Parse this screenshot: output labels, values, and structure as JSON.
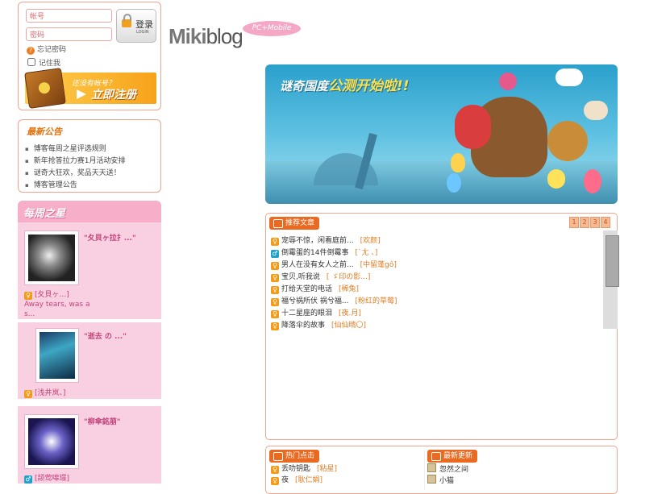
{
  "login": {
    "account_placeholder": "帐号",
    "password_placeholder": "密码",
    "login_label": "登录",
    "login_sub": "LOGIN",
    "forgot": "忘记密码",
    "remember": "记住我",
    "register_question": "还没有帐号？",
    "register_label": "立即注册"
  },
  "logo": {
    "miki": "Miki",
    "blog": "blog",
    "tag": "PC+Mobile"
  },
  "news": {
    "title": "最新公告",
    "items": [
      "博客每周之星评选规则",
      "新年抢答拉力赛1月活动安排",
      "谜奇大狂欢，奖品天天送！",
      "博客管理公告"
    ]
  },
  "weekly": {
    "title": "每周之星",
    "stars": [
      {
        "name": "\"夂貝ヶ拉扌...\"",
        "user": "[夂貝ヶ...]",
        "desc": "Away tears, was a s..."
      },
      {
        "name": "\"逝去 の ...\"",
        "user": "[浅井岚、]",
        "desc": ""
      },
      {
        "name": "\"柳傘銘萠\"",
        "user": "[颉莺嗥璟]",
        "desc": ""
      }
    ]
  },
  "banner": {
    "text_a": "谜奇国度",
    "text_b": "公测开始啦!!"
  },
  "recommend": {
    "title": "推荐文章",
    "pages": [
      "1",
      "2",
      "3",
      "4"
    ],
    "items": [
      {
        "title": "宠辱不惊，闲看庭前...",
        "author": "[欢颜]"
      },
      {
        "title": "倒霉蛋的14件倒霉事",
        "author": "[ˋ尢 、]"
      },
      {
        "title": "男人在没有女人之前...",
        "author": "[中留蓬gô]"
      },
      {
        "title": "宝贝,听我说",
        "author": "[ ゞ印の影...]"
      },
      {
        "title": "打给天堂的电话",
        "author": "[稀兔]"
      },
      {
        "title": "福兮祸所伏 祸兮福...",
        "author": "[粉红的草莓]"
      },
      {
        "title": "十二星座的眼泪",
        "author": "[夜.月]"
      },
      {
        "title": "降落伞的故事",
        "author": "[仙仙晴〇]"
      }
    ]
  },
  "hot": {
    "title": "热门点击",
    "items": [
      {
        "title": "丢叻钥匙",
        "author": "[粘星]"
      },
      {
        "title": "夜",
        "author": "[耿仁娟]"
      }
    ]
  },
  "latest": {
    "title": "最新更新",
    "items": [
      {
        "title": "忽然之间"
      },
      {
        "title": "小猫"
      }
    ]
  },
  "colors": {
    "accent": "#ea6a22",
    "pink": "#f6aec9",
    "border": "#f1a48b"
  }
}
